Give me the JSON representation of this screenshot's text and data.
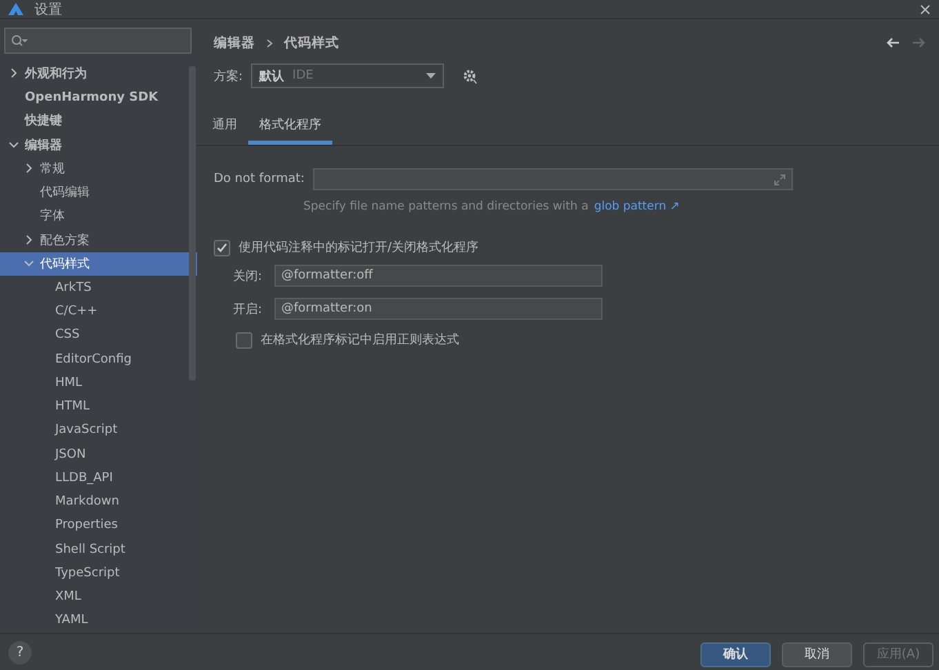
{
  "window": {
    "title": "设置"
  },
  "sidebar": {
    "items": [
      {
        "label": "外观和行为",
        "expanded": false,
        "selected": false
      },
      {
        "label": "OpenHarmony SDK",
        "selected": false
      },
      {
        "label": "快捷键",
        "selected": false
      },
      {
        "label": "编辑器",
        "expanded": true,
        "selected": false,
        "children": [
          {
            "label": "常规",
            "expanded": false,
            "selected": false
          },
          {
            "label": "代码编辑",
            "selected": false
          },
          {
            "label": "字体",
            "selected": false
          },
          {
            "label": "配色方案",
            "expanded": false,
            "selected": false
          },
          {
            "label": "代码样式",
            "expanded": true,
            "selected": true,
            "children": [
              {
                "label": "ArkTS",
                "selected": false
              },
              {
                "label": "C/C++",
                "selected": false
              },
              {
                "label": "CSS",
                "selected": false
              },
              {
                "label": "EditorConfig",
                "selected": false
              },
              {
                "label": "HML",
                "selected": false
              },
              {
                "label": "HTML",
                "selected": false
              },
              {
                "label": "JavaScript",
                "selected": false
              },
              {
                "label": "JSON",
                "selected": false
              },
              {
                "label": "LLDB_API",
                "selected": false
              },
              {
                "label": "Markdown",
                "selected": false
              },
              {
                "label": "Properties",
                "selected": false
              },
              {
                "label": "Shell Script",
                "selected": false
              },
              {
                "label": "TypeScript",
                "selected": false
              },
              {
                "label": "XML",
                "selected": false
              },
              {
                "label": "YAML",
                "selected": false
              }
            ]
          }
        ]
      }
    ]
  },
  "breadcrumb": [
    "编辑器",
    "代码样式"
  ],
  "scheme": {
    "label": "方案:",
    "value": "默认",
    "hint": "IDE"
  },
  "tabs": [
    {
      "label": "通用",
      "selected": false
    },
    {
      "label": "格式化程序",
      "selected": true
    }
  ],
  "do_not_format": {
    "label": "Do not format:",
    "hint": "Specify file name patterns and directories with a",
    "link": "glob pattern ↗"
  },
  "formatter_markers": {
    "label": "使用代码注释中的标记打开/关闭格式化程序",
    "checked": true,
    "fields": [
      {
        "label": "关闭:",
        "value": "@formatter:off"
      },
      {
        "label": "开启:",
        "value": "@formatter:on"
      }
    ],
    "regex": {
      "label": "在格式化程序标记中启用正则表达式",
      "checked": false
    }
  },
  "buttons": [
    {
      "label": "确认",
      "kind": "primary",
      "disabled": false
    },
    {
      "label": "取消",
      "kind": "normal",
      "disabled": false
    },
    {
      "label": "应用(A)",
      "kind": "normal",
      "disabled": true
    }
  ],
  "help": "?"
}
